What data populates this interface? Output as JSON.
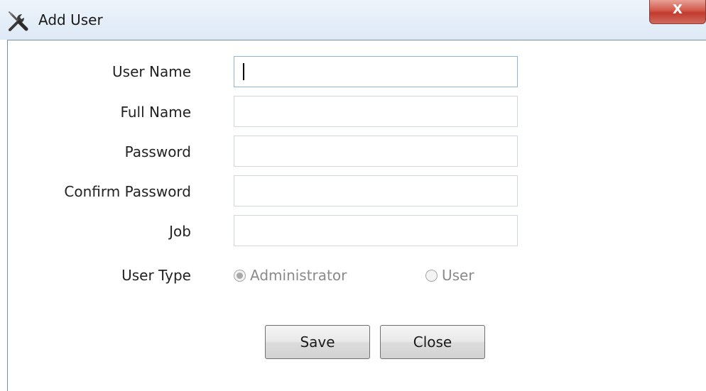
{
  "window": {
    "title": "Add User",
    "close_glyph": "X",
    "title_icon": "tools-icon"
  },
  "form": {
    "fields": [
      {
        "label": "User Name",
        "value": "",
        "focused": true
      },
      {
        "label": "Full Name",
        "value": ""
      },
      {
        "label": "Password",
        "value": ""
      },
      {
        "label": "Confirm Password",
        "value": ""
      },
      {
        "label": "Job",
        "value": ""
      }
    ],
    "user_type": {
      "label": "User Type",
      "options": [
        {
          "label": "Administrator",
          "checked": true
        },
        {
          "label": "User",
          "checked": false
        }
      ]
    }
  },
  "buttons": {
    "save": "Save",
    "close": "Close"
  }
}
